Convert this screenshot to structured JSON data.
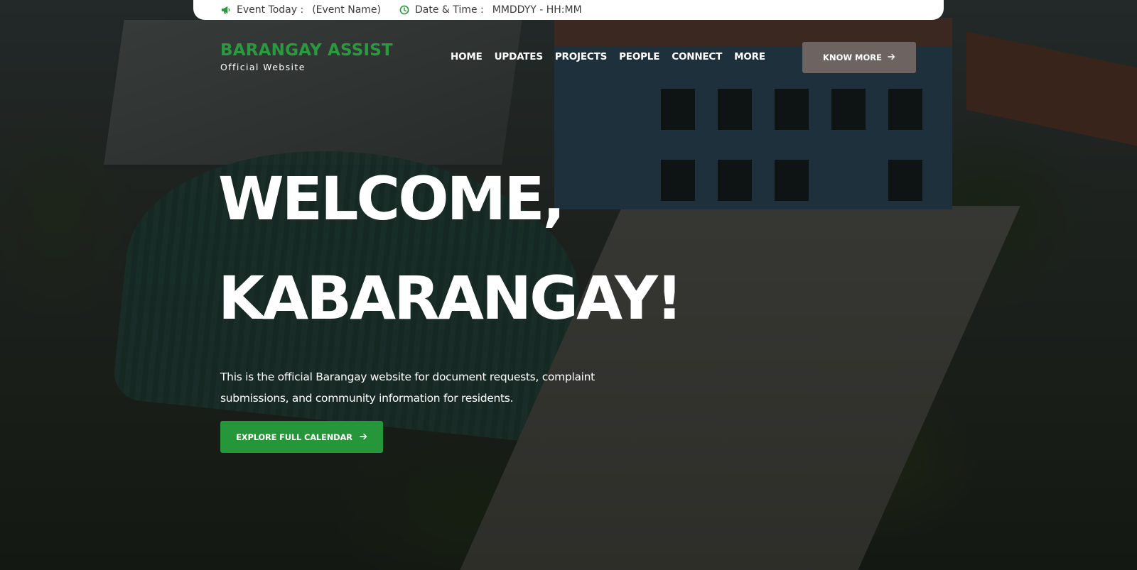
{
  "event_bar": {
    "event_label": "Event Today :",
    "event_value": "(Event Name)",
    "datetime_label": "Date & Time :",
    "datetime_value": "MMDDYY - HH:MM",
    "event_icon": "megaphone-icon",
    "clock_icon": "clock-icon"
  },
  "header": {
    "brand_title": "BARANGAY ASSIST",
    "brand_subtitle": "Official Website",
    "nav": [
      "HOME",
      "UPDATES",
      "PROJECTS",
      "PEOPLE",
      "CONNECT",
      "MORE"
    ],
    "cta_label": "KNOW MORE",
    "cta_icon": "arrow-right-icon"
  },
  "hero": {
    "headline_line1": "WELCOME,",
    "headline_line2": "KABARANGAY!",
    "description": "This is the official Barangay website for document requests, complaint submissions, and community information for residents.",
    "cta_label": "EXPLORE FULL CALENDAR",
    "cta_icon": "arrow-right-icon"
  },
  "colors": {
    "brand_green": "#2a9a3e",
    "cta_green": "#25963a",
    "know_more_bg": "#6d6462",
    "overlay": "rgba(8,10,8,0.68)"
  }
}
